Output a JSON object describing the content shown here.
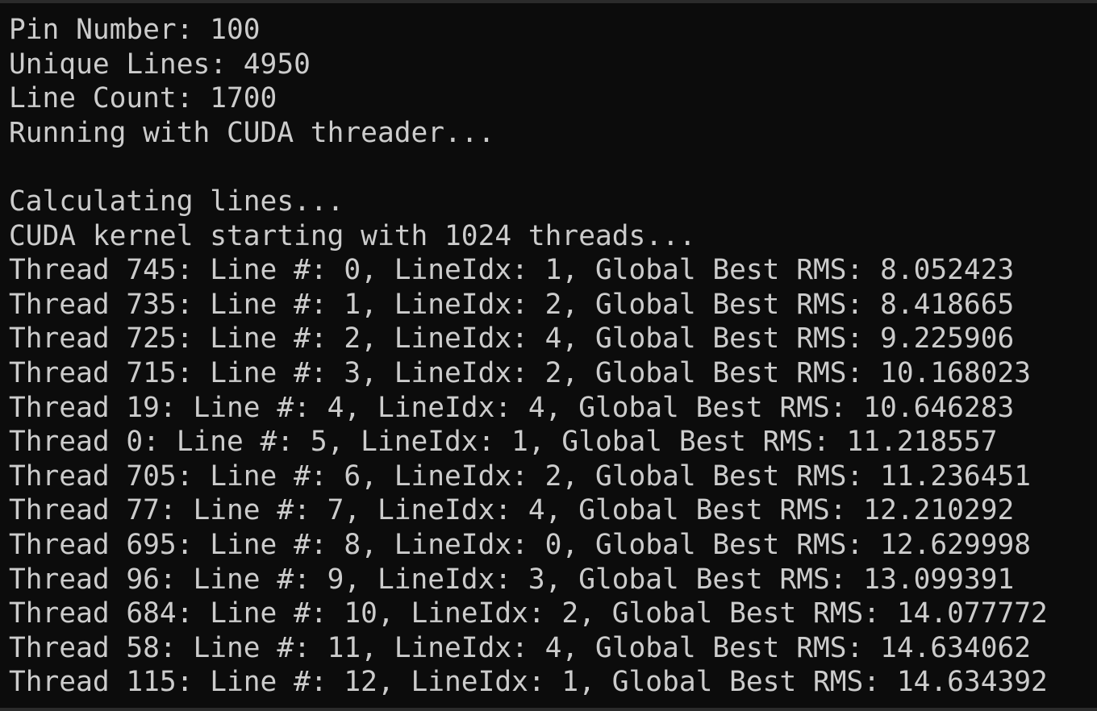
{
  "console": {
    "header": [
      "Pin Number: 100",
      "Unique Lines: 4950",
      "Line Count: 1700",
      "Running with CUDA threader..."
    ],
    "status": [
      "Calculating lines...",
      "CUDA kernel starting with 1024 threads..."
    ],
    "threads": [
      "Thread 745: Line #: 0, LineIdx: 1, Global Best RMS: 8.052423",
      "Thread 735: Line #: 1, LineIdx: 2, Global Best RMS: 8.418665",
      "Thread 725: Line #: 2, LineIdx: 4, Global Best RMS: 9.225906",
      "Thread 715: Line #: 3, LineIdx: 2, Global Best RMS: 10.168023",
      "Thread 19: Line #: 4, LineIdx: 4, Global Best RMS: 10.646283",
      "Thread 0: Line #: 5, LineIdx: 1, Global Best RMS: 11.218557",
      "Thread 705: Line #: 6, LineIdx: 2, Global Best RMS: 11.236451",
      "Thread 77: Line #: 7, LineIdx: 4, Global Best RMS: 12.210292",
      "Thread 695: Line #: 8, LineIdx: 0, Global Best RMS: 12.629998",
      "Thread 96: Line #: 9, LineIdx: 3, Global Best RMS: 13.099391",
      "Thread 684: Line #: 10, LineIdx: 2, Global Best RMS: 14.077772",
      "Thread 58: Line #: 11, LineIdx: 4, Global Best RMS: 14.634062",
      "Thread 115: Line #: 12, LineIdx: 1, Global Best RMS: 14.634392"
    ],
    "colors": {
      "background": "#0c0c0c",
      "text": "#cccccc"
    }
  }
}
